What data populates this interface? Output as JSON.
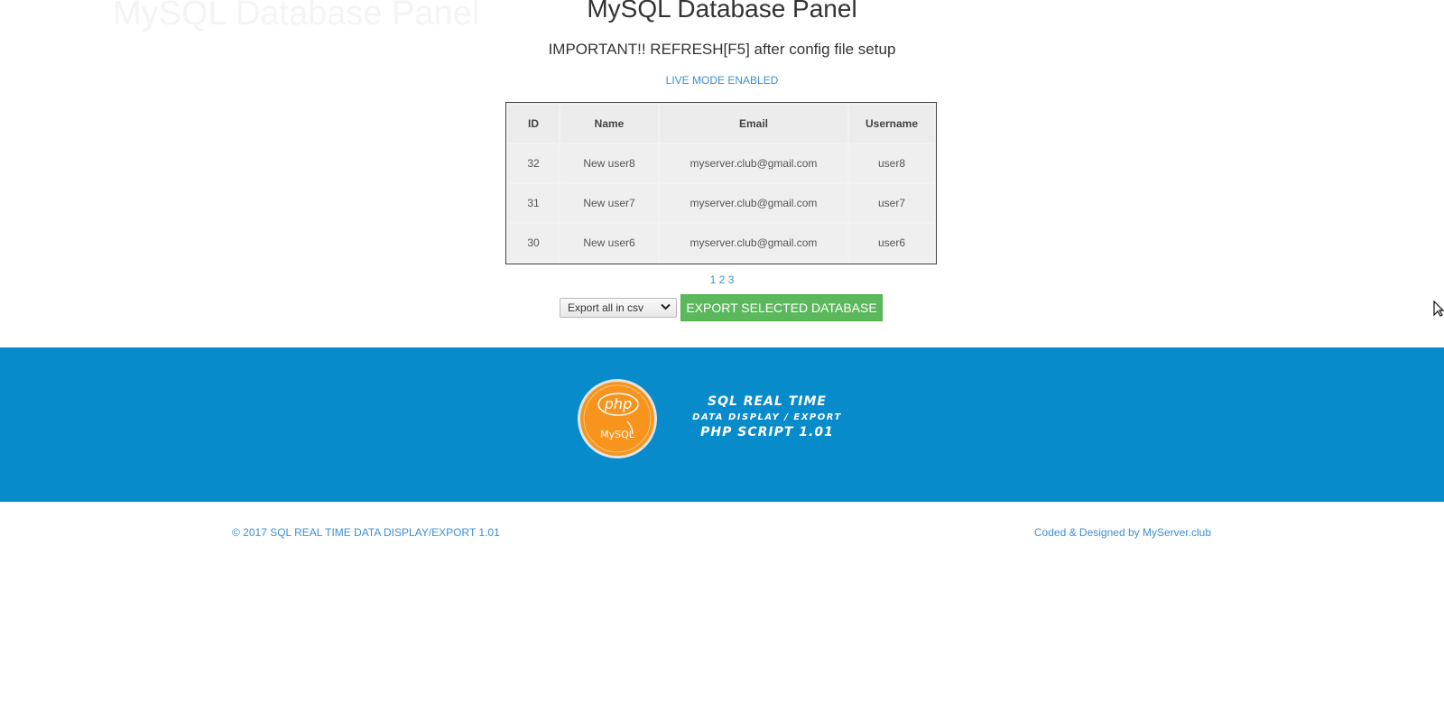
{
  "header": {
    "watermark": "MySQL Database Panel",
    "title": "MySQL Database Panel",
    "subtitle": "IMPORTANT!! REFRESH[F5] after config file setup",
    "live_status": "LIVE MODE ENABLED"
  },
  "table": {
    "columns": [
      "ID",
      "Name",
      "Email",
      "Username"
    ],
    "rows": [
      {
        "id": "32",
        "name": "New user8",
        "email": "myserver.club@gmail.com",
        "username": "user8"
      },
      {
        "id": "31",
        "name": "New user7",
        "email": "myserver.club@gmail.com",
        "username": "user7"
      },
      {
        "id": "30",
        "name": "New user6",
        "email": "myserver.club@gmail.com",
        "username": "user6"
      }
    ]
  },
  "pagination": {
    "pages": [
      "1",
      "2",
      "3"
    ]
  },
  "export": {
    "selected_option": "Export all in csv",
    "button_label": "EXPORT SELECTED DATABASE"
  },
  "banner": {
    "logo_top": "php",
    "logo_bottom": "MySQL",
    "line1": "SQL REAL TIME",
    "line2": "DATA DISPLAY / EXPORT",
    "line3": "PHP SCRIPT 1.01"
  },
  "footer": {
    "copyright": "© 2017 SQL REAL TIME DATA DISPLAY/EXPORT 1.01",
    "credit": "Coded & Designed by MyServer.club"
  },
  "colors": {
    "link": "#3a8fd6",
    "banner": "#078bcb",
    "button": "#5cb85c",
    "logo": "#f7941d"
  },
  "icons": {
    "select_chevron": "chevron-down-icon",
    "cursor": "mouse-cursor-icon"
  }
}
